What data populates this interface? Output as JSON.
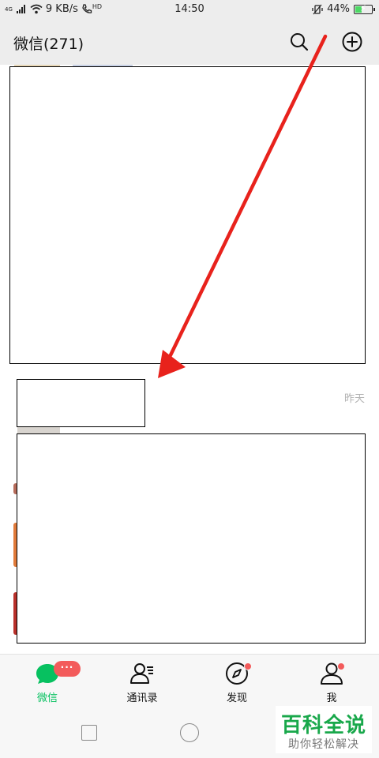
{
  "status_bar": {
    "network_type": "4G",
    "speed": "9 KB/s",
    "hd": "HD",
    "time": "14:50",
    "battery": "44%",
    "battery_level": 0.44
  },
  "header": {
    "title": "微信(271)",
    "icons": [
      "search-icon",
      "add-circle-icon"
    ]
  },
  "chat_list": {
    "visible_time": "昨天"
  },
  "tabs": [
    {
      "label": "微信",
      "icon": "chat-bubble-icon",
      "active": true,
      "badge": "···"
    },
    {
      "label": "通讯录",
      "icon": "contacts-icon",
      "active": false,
      "red_dot": false
    },
    {
      "label": "发现",
      "icon": "compass-icon",
      "active": false,
      "red_dot": true
    },
    {
      "label": "我",
      "icon": "person-icon",
      "active": false,
      "red_dot": true
    }
  ],
  "annotation": {
    "arrow_color": "#e8221c"
  },
  "watermark": {
    "title": "百科全说",
    "subtitle": "助你轻松解决"
  },
  "colors": {
    "accent": "#07c160",
    "badge": "#f35b5b",
    "header_bg": "#ededed"
  }
}
